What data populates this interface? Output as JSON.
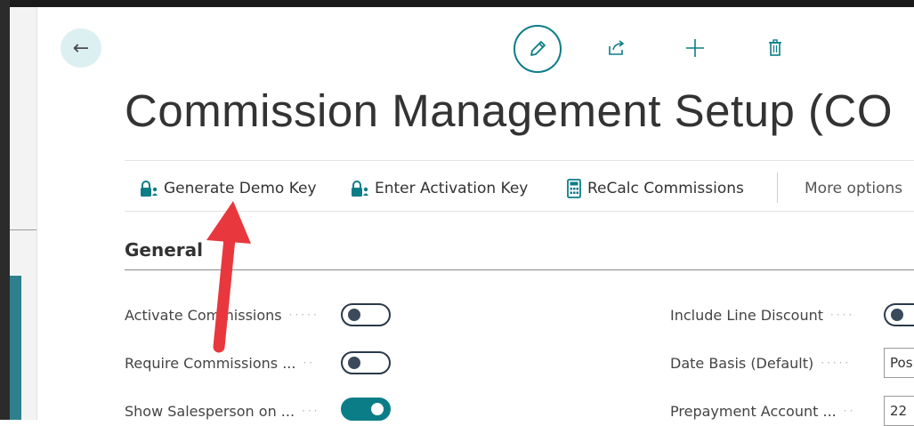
{
  "page": {
    "title": "Commission Management Setup (CO"
  },
  "toolbar": {
    "back_label": "Back",
    "actions": [
      {
        "label": "Generate Demo Key",
        "icon": "key-person-icon"
      },
      {
        "label": "Enter Activation Key",
        "icon": "key-person-icon"
      },
      {
        "label": "ReCalc Commissions",
        "icon": "calculator-icon"
      }
    ],
    "more_options": "More options"
  },
  "section": {
    "title": "General"
  },
  "fields_left": [
    {
      "label": "Activate Commissions",
      "value": false
    },
    {
      "label": "Require Commissions ...",
      "value": false
    },
    {
      "label": "Show Salesperson on ...",
      "value": true
    }
  ],
  "fields_right": [
    {
      "label": "Include Line Discount",
      "type": "toggle",
      "value": false
    },
    {
      "label": "Date Basis (Default)",
      "type": "select",
      "value": "Pos"
    },
    {
      "label": "Prepayment Account ...",
      "type": "input",
      "value": "22"
    }
  ],
  "colors": {
    "accent": "#0b7d87",
    "annotation_arrow": "#e8383d"
  }
}
